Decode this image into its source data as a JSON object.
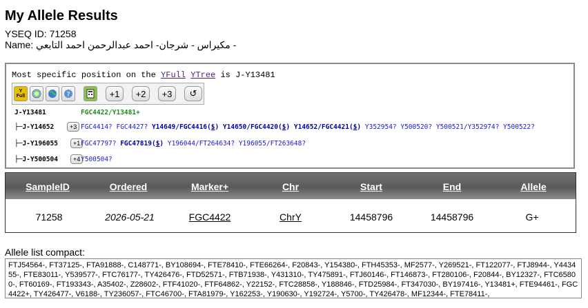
{
  "page": {
    "title": "My Allele Results",
    "yseq_id": "YSEQ ID: 71258",
    "name": "Name: مكيراس - شرجان- احمد عبدالرحمن احمد التابعي -"
  },
  "ytree": {
    "prefix": "Most specific position on the ",
    "link_yfull": "YFull",
    "link_ytree": "YTree",
    "suffix": " is J-Y13481",
    "tool_plus1": "+1",
    "tool_plus2": "+2",
    "tool_plus3": "+3",
    "tool_reset": "↺",
    "rows": [
      {
        "node": "J-Y13481",
        "snps": "FGC4422/Y13481+"
      },
      {
        "node": "├─J-Y14652",
        "plus": "+3",
        "snps_plain1": "FGC4414? FGC4427? ",
        "snps_bold": "Y14649/FGC4416(",
        "snps_bold_u": "$",
        "snps_bold2": ") Y14650/FGC4420(",
        "snps_bold_u2": "$",
        "snps_bold3": ") Y14652/FGC4421(",
        "snps_bold_u3": "$",
        "snps_bold4": ")",
        "snps_plain2": " Y352954? Y500520? Y500521/Y352974? Y500522?"
      },
      {
        "node": "├─J-Y196055",
        "plus": "+1",
        "snps_plain1": "FGC47797? ",
        "snps_bold": "FGC47819(",
        "snps_bold_u": "$",
        "snps_bold2": ")",
        "snps_plain2": " Y196044/FT264634? Y196055/FT263648?"
      },
      {
        "node": "├─J-Y500504",
        "plus": "+4",
        "snps_plain1": "Y500504?"
      }
    ]
  },
  "table": {
    "headers": [
      "SampleID",
      "Ordered",
      "Marker+",
      "Chr",
      "Start",
      "End",
      "Allele"
    ],
    "row": {
      "sample_id": "71258",
      "ordered": "2026-05-21",
      "marker": "FGC4422",
      "chr": "ChrY",
      "start": "14458796",
      "end": "14458796",
      "allele": "G+"
    }
  },
  "allele_list": {
    "label": "Allele list compact:",
    "value": "FTJ54564-, FT37125-, FTA91888-, C148771-, BY108694-, FTE78410-, FTE66264-, F20843-, Y154380-, FTH45353-, MF2577-, Y269521-, FT122077-, FTJ8944-, Y443455-, FTE83011-, Y539577-, FTC76177-, TY426476-, FTD52571-, FTB71938-, Y431310-, TY475891-, FTJ60146-, FT146873-, FT280106-, F20844-, BY12327-, FTC65800-, FT60169-, FT193343-, A35402-, Z28602-, FTF41020-, FTF64862-, Y22152-, FTC28858-, Y188846-, FTD25984-, FT347030-, BY197416-, Y13481+, FTE94461-, FGC4422+, TY426477-, V6188-, TY236057-, FTC46700-, FTA81979-, Y162253-, Y190630-, Y192724-, Y5700-, TY426478-, MF12344-, FTE78411-,"
  }
}
